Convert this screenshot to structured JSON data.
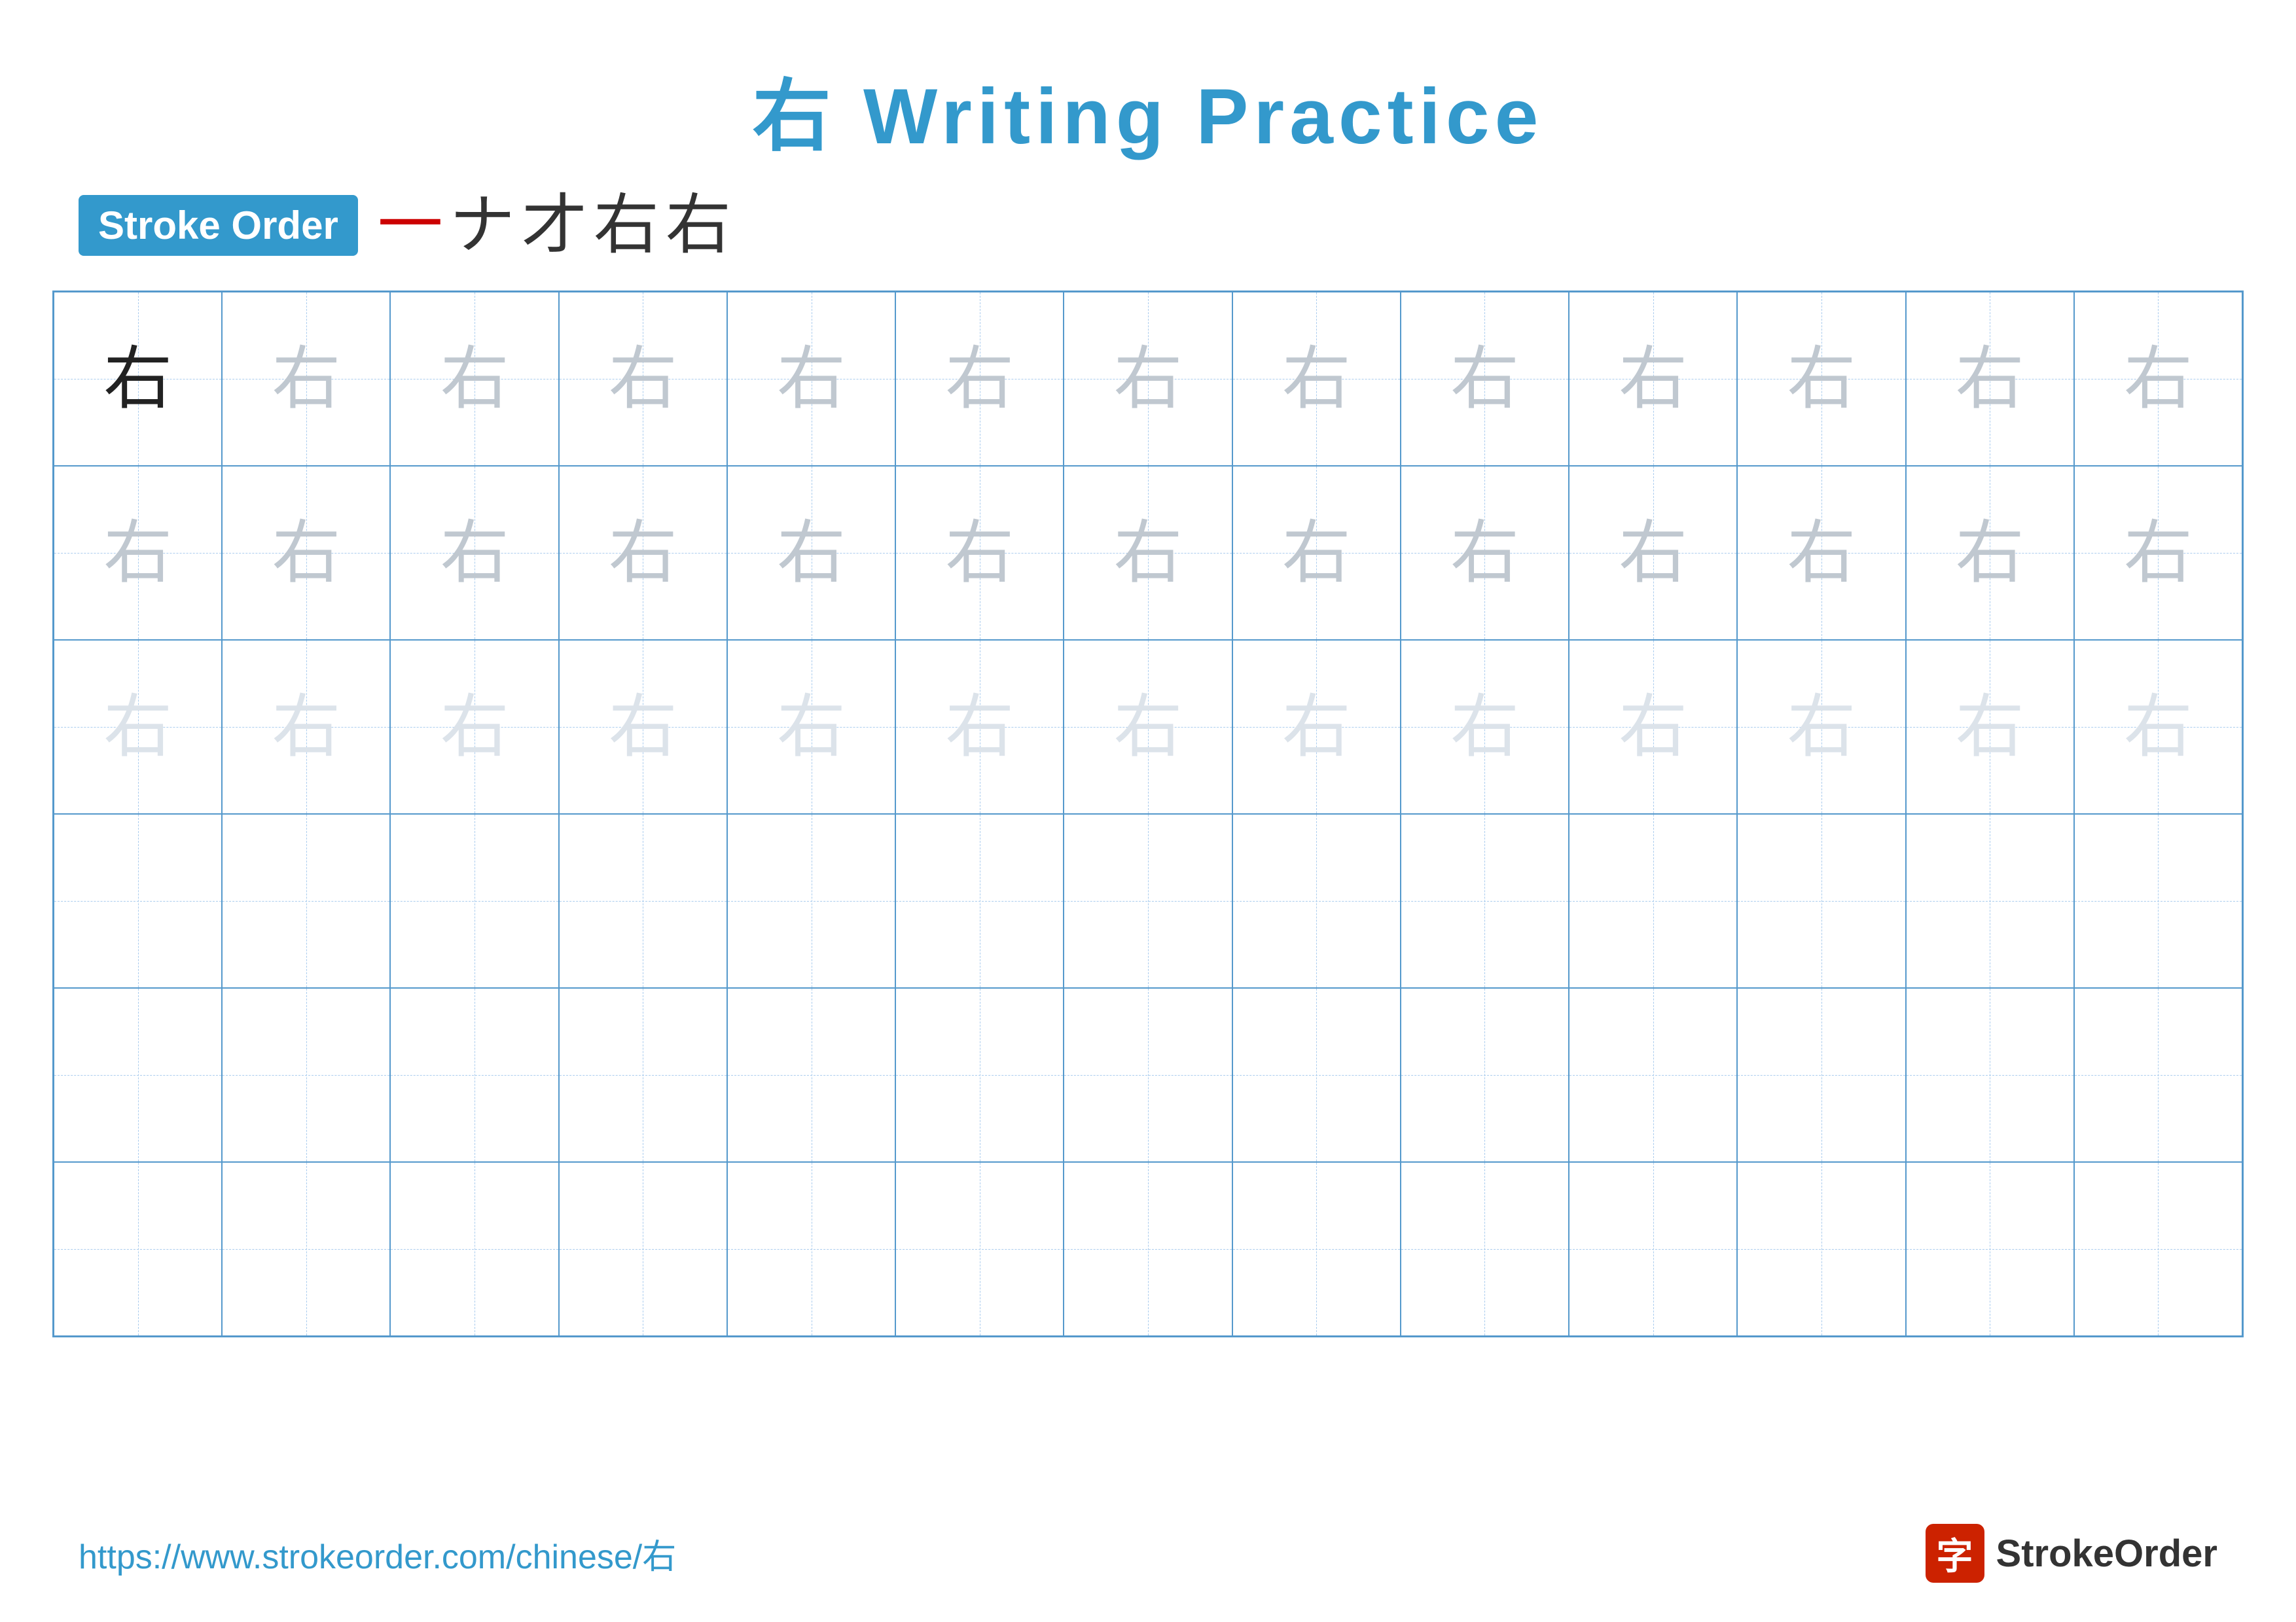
{
  "title": {
    "character": "右",
    "label": "Writing Practice",
    "full": "右 Writing Practice"
  },
  "stroke_order": {
    "badge": "Stroke Order",
    "sequence": [
      "一",
      "ナ",
      "才",
      "右",
      "右"
    ],
    "red_index": 0
  },
  "grid": {
    "rows": 6,
    "cols": 13,
    "character": "右",
    "row_styles": [
      "dark+medium",
      "medium",
      "light",
      "empty",
      "empty",
      "empty"
    ]
  },
  "footer": {
    "url": "https://www.strokeorder.com/chinese/右",
    "logo_icon": "字",
    "logo_text": "StrokeOrder"
  }
}
